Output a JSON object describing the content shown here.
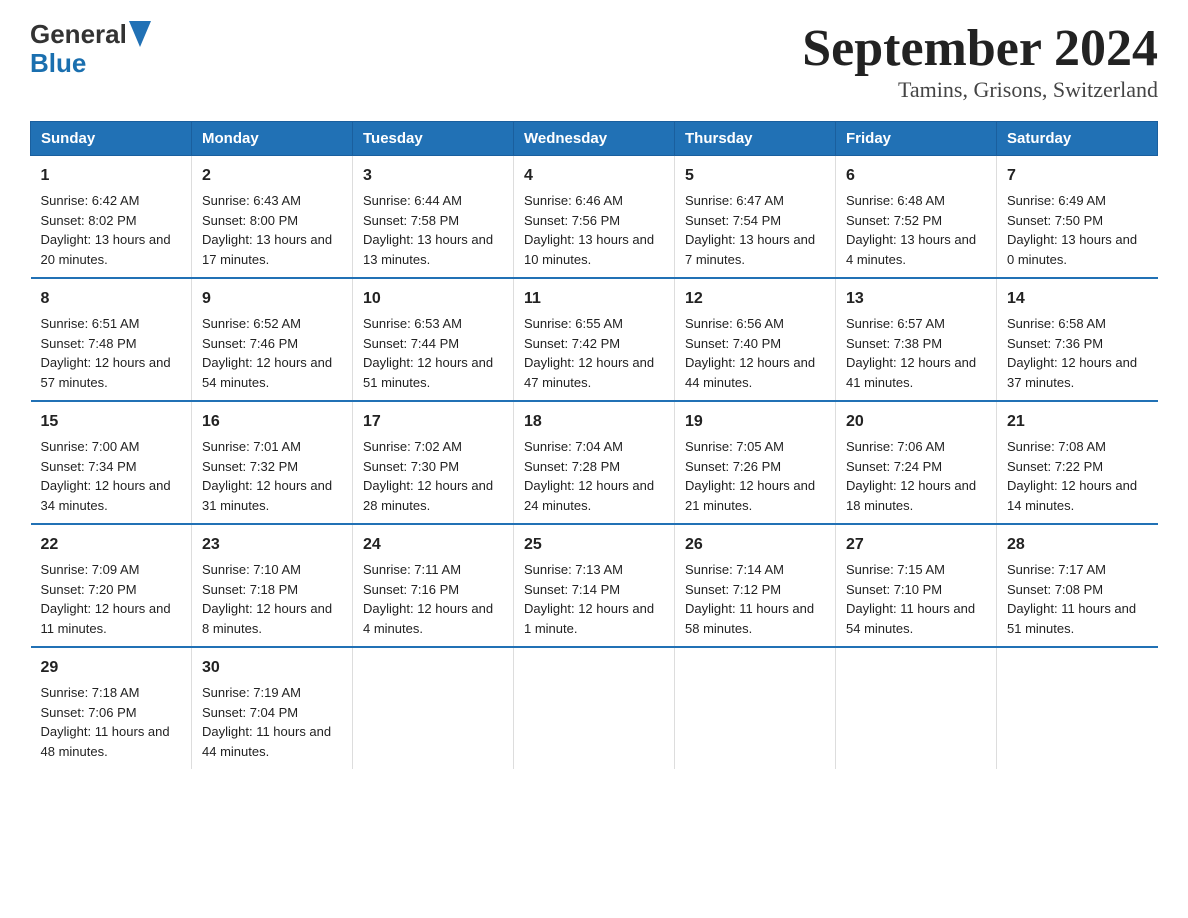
{
  "header": {
    "logo_general": "General",
    "logo_blue": "Blue",
    "title": "September 2024",
    "subtitle": "Tamins, Grisons, Switzerland"
  },
  "weekdays": [
    "Sunday",
    "Monday",
    "Tuesday",
    "Wednesday",
    "Thursday",
    "Friday",
    "Saturday"
  ],
  "weeks": [
    [
      {
        "day": "1",
        "sunrise": "6:42 AM",
        "sunset": "8:02 PM",
        "daylight": "13 hours and 20 minutes."
      },
      {
        "day": "2",
        "sunrise": "6:43 AM",
        "sunset": "8:00 PM",
        "daylight": "13 hours and 17 minutes."
      },
      {
        "day": "3",
        "sunrise": "6:44 AM",
        "sunset": "7:58 PM",
        "daylight": "13 hours and 13 minutes."
      },
      {
        "day": "4",
        "sunrise": "6:46 AM",
        "sunset": "7:56 PM",
        "daylight": "13 hours and 10 minutes."
      },
      {
        "day": "5",
        "sunrise": "6:47 AM",
        "sunset": "7:54 PM",
        "daylight": "13 hours and 7 minutes."
      },
      {
        "day": "6",
        "sunrise": "6:48 AM",
        "sunset": "7:52 PM",
        "daylight": "13 hours and 4 minutes."
      },
      {
        "day": "7",
        "sunrise": "6:49 AM",
        "sunset": "7:50 PM",
        "daylight": "13 hours and 0 minutes."
      }
    ],
    [
      {
        "day": "8",
        "sunrise": "6:51 AM",
        "sunset": "7:48 PM",
        "daylight": "12 hours and 57 minutes."
      },
      {
        "day": "9",
        "sunrise": "6:52 AM",
        "sunset": "7:46 PM",
        "daylight": "12 hours and 54 minutes."
      },
      {
        "day": "10",
        "sunrise": "6:53 AM",
        "sunset": "7:44 PM",
        "daylight": "12 hours and 51 minutes."
      },
      {
        "day": "11",
        "sunrise": "6:55 AM",
        "sunset": "7:42 PM",
        "daylight": "12 hours and 47 minutes."
      },
      {
        "day": "12",
        "sunrise": "6:56 AM",
        "sunset": "7:40 PM",
        "daylight": "12 hours and 44 minutes."
      },
      {
        "day": "13",
        "sunrise": "6:57 AM",
        "sunset": "7:38 PM",
        "daylight": "12 hours and 41 minutes."
      },
      {
        "day": "14",
        "sunrise": "6:58 AM",
        "sunset": "7:36 PM",
        "daylight": "12 hours and 37 minutes."
      }
    ],
    [
      {
        "day": "15",
        "sunrise": "7:00 AM",
        "sunset": "7:34 PM",
        "daylight": "12 hours and 34 minutes."
      },
      {
        "day": "16",
        "sunrise": "7:01 AM",
        "sunset": "7:32 PM",
        "daylight": "12 hours and 31 minutes."
      },
      {
        "day": "17",
        "sunrise": "7:02 AM",
        "sunset": "7:30 PM",
        "daylight": "12 hours and 28 minutes."
      },
      {
        "day": "18",
        "sunrise": "7:04 AM",
        "sunset": "7:28 PM",
        "daylight": "12 hours and 24 minutes."
      },
      {
        "day": "19",
        "sunrise": "7:05 AM",
        "sunset": "7:26 PM",
        "daylight": "12 hours and 21 minutes."
      },
      {
        "day": "20",
        "sunrise": "7:06 AM",
        "sunset": "7:24 PM",
        "daylight": "12 hours and 18 minutes."
      },
      {
        "day": "21",
        "sunrise": "7:08 AM",
        "sunset": "7:22 PM",
        "daylight": "12 hours and 14 minutes."
      }
    ],
    [
      {
        "day": "22",
        "sunrise": "7:09 AM",
        "sunset": "7:20 PM",
        "daylight": "12 hours and 11 minutes."
      },
      {
        "day": "23",
        "sunrise": "7:10 AM",
        "sunset": "7:18 PM",
        "daylight": "12 hours and 8 minutes."
      },
      {
        "day": "24",
        "sunrise": "7:11 AM",
        "sunset": "7:16 PM",
        "daylight": "12 hours and 4 minutes."
      },
      {
        "day": "25",
        "sunrise": "7:13 AM",
        "sunset": "7:14 PM",
        "daylight": "12 hours and 1 minute."
      },
      {
        "day": "26",
        "sunrise": "7:14 AM",
        "sunset": "7:12 PM",
        "daylight": "11 hours and 58 minutes."
      },
      {
        "day": "27",
        "sunrise": "7:15 AM",
        "sunset": "7:10 PM",
        "daylight": "11 hours and 54 minutes."
      },
      {
        "day": "28",
        "sunrise": "7:17 AM",
        "sunset": "7:08 PM",
        "daylight": "11 hours and 51 minutes."
      }
    ],
    [
      {
        "day": "29",
        "sunrise": "7:18 AM",
        "sunset": "7:06 PM",
        "daylight": "11 hours and 48 minutes."
      },
      {
        "day": "30",
        "sunrise": "7:19 AM",
        "sunset": "7:04 PM",
        "daylight": "11 hours and 44 minutes."
      },
      {
        "day": "",
        "sunrise": "",
        "sunset": "",
        "daylight": ""
      },
      {
        "day": "",
        "sunrise": "",
        "sunset": "",
        "daylight": ""
      },
      {
        "day": "",
        "sunrise": "",
        "sunset": "",
        "daylight": ""
      },
      {
        "day": "",
        "sunrise": "",
        "sunset": "",
        "daylight": ""
      },
      {
        "day": "",
        "sunrise": "",
        "sunset": "",
        "daylight": ""
      }
    ]
  ]
}
